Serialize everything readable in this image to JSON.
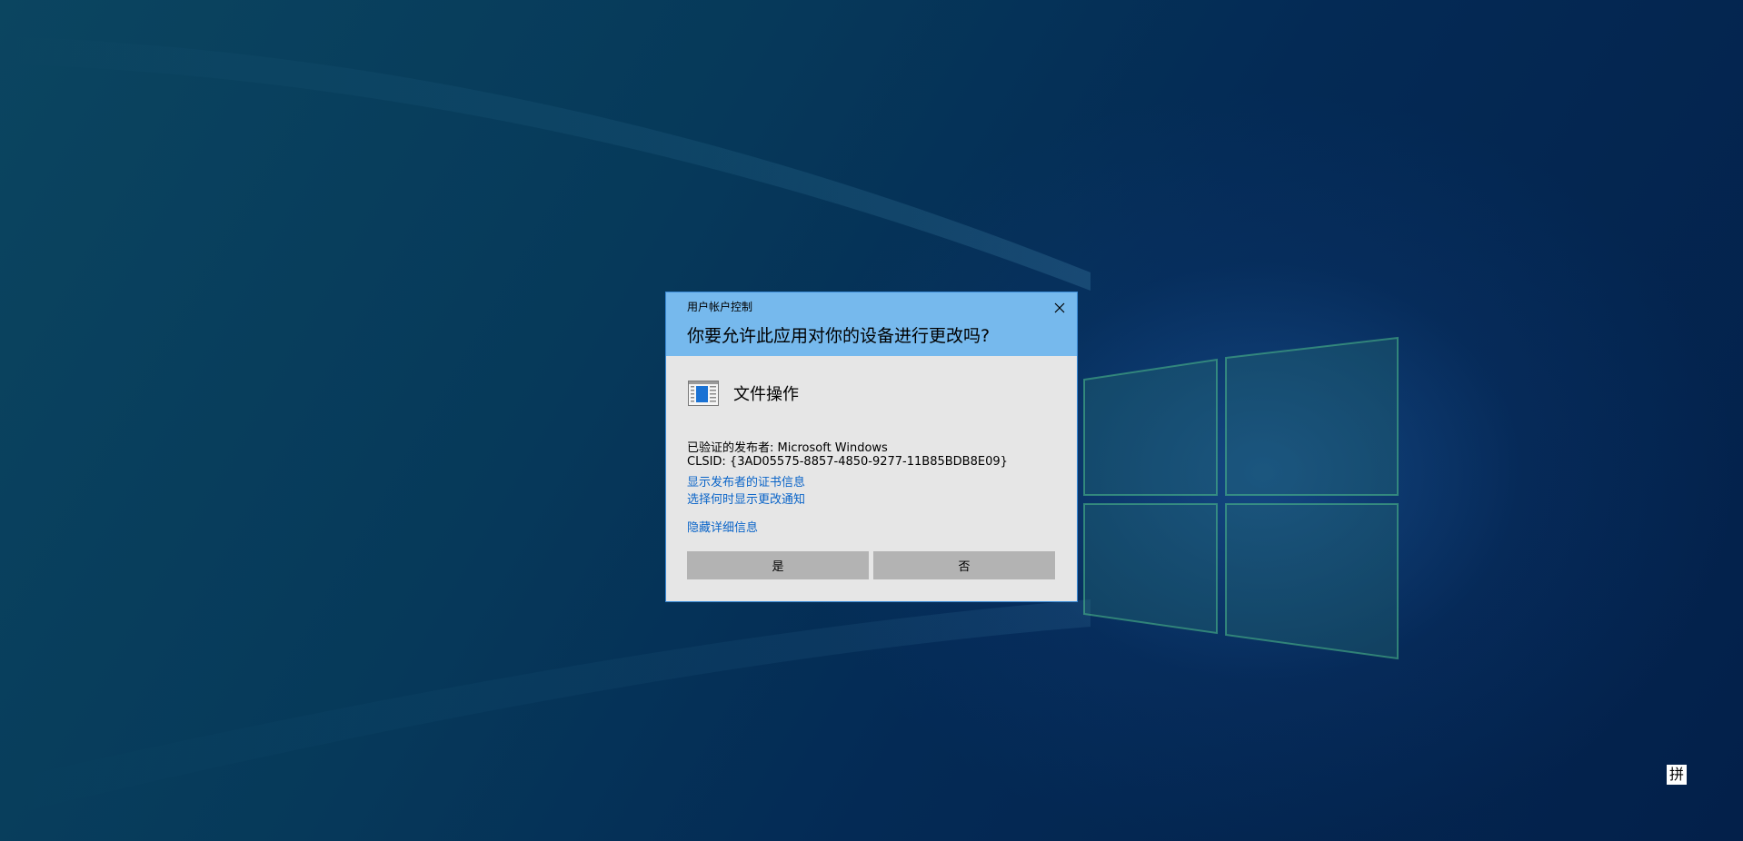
{
  "desktop": {
    "background_colors": [
      "#0b4560",
      "#042a55",
      "#03204a"
    ],
    "logo_color": "#3f8f6e"
  },
  "uac": {
    "caption": "用户帐户控制",
    "question": "你要允许此应用对你的设备进行更改吗?",
    "header_color": "#76b9ed",
    "app_name": "文件操作",
    "publisher_line": "已验证的发布者: Microsoft Windows",
    "clsid_line": "CLSID: {3AD05575-8857-4850-9277-11B85BDB8E09}",
    "links": {
      "show_certificate": "显示发布者的证书信息",
      "change_notification": "选择何时显示更改通知",
      "hide_details": "隐藏详细信息"
    },
    "buttons": {
      "yes": "是",
      "no": "否"
    },
    "icons": {
      "close": "close-icon",
      "app": "app-window-icon"
    }
  },
  "taskbar": {
    "ime_indicator": "拼"
  }
}
